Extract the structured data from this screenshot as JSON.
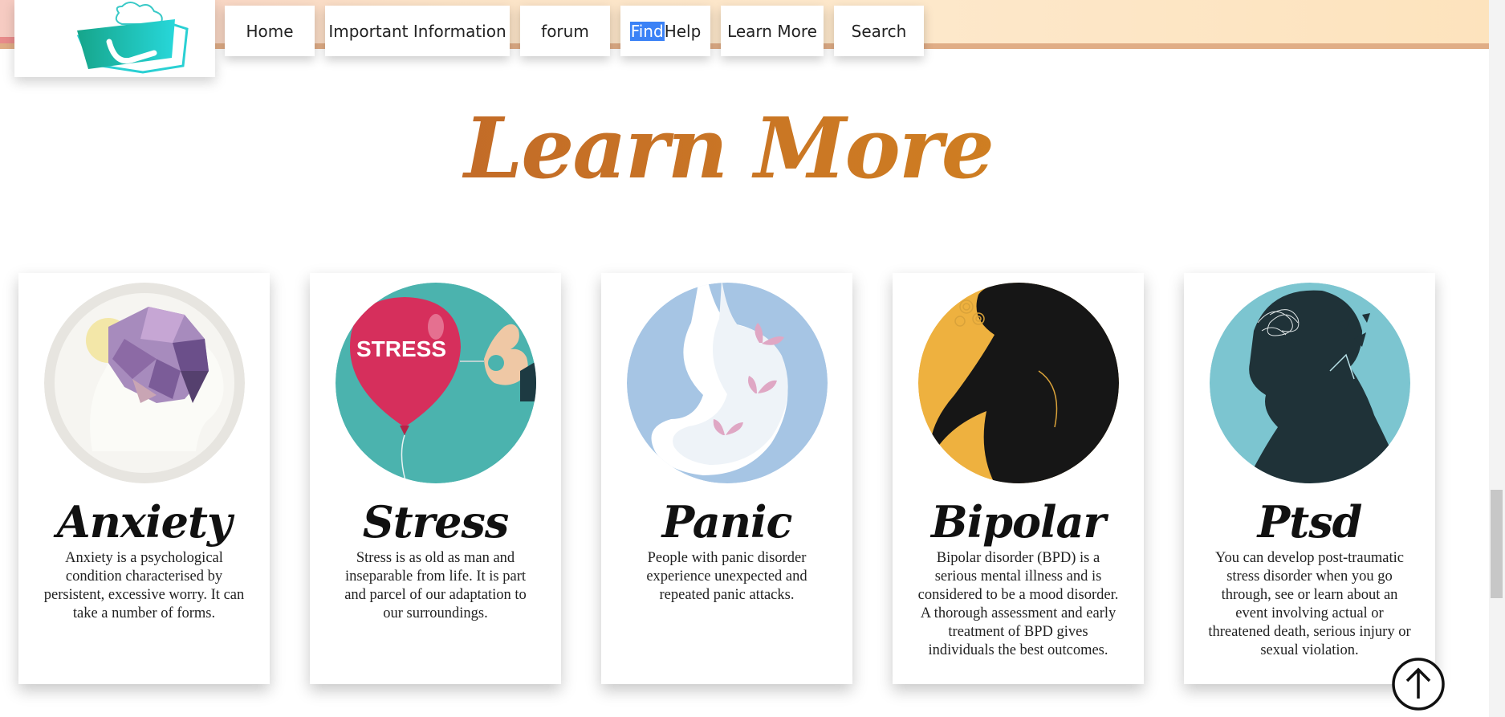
{
  "nav": {
    "home": "Home",
    "important": "Important Information",
    "forum": "forum",
    "find_highlight": "Find",
    "find_rest": "Help",
    "learn_more": "Learn More",
    "search": "Search"
  },
  "page": {
    "heading": "Learn More"
  },
  "cards": [
    {
      "title": "Anxiety",
      "text": "Anxiety is a psychological condition characterised by persistent, excessive worry. It can take a number of forms."
    },
    {
      "title": "Stress",
      "text": "Stress is as old as man and inseparable from life. It is part and parcel of our adaptation to our surroundings."
    },
    {
      "title": "Panic",
      "text": "People with panic disorder experience unexpected and repeated panic attacks."
    },
    {
      "title": "Bipolar",
      "text": "Bipolar disorder (BPD) is a serious mental illness and is considered to be a mood disorder. A thorough assessment and early treatment of BPD gives individuals the best outcomes."
    },
    {
      "title": "Ptsd",
      "text": "You can develop post-traumatic stress disorder when you go through, see or learn about an event involving actual or threatened death, serious injury or sexual violation."
    }
  ],
  "illustrations": {
    "stress_balloon_text": "STRESS"
  },
  "icons": {
    "logo": "cloud-check-logo",
    "scroll_top": "arrow-up-circle-icon"
  },
  "colors": {
    "heading_gradient_start": "#b85c2c",
    "heading_gradient_end": "#d98d1c",
    "find_highlight": "#3b82f6"
  }
}
